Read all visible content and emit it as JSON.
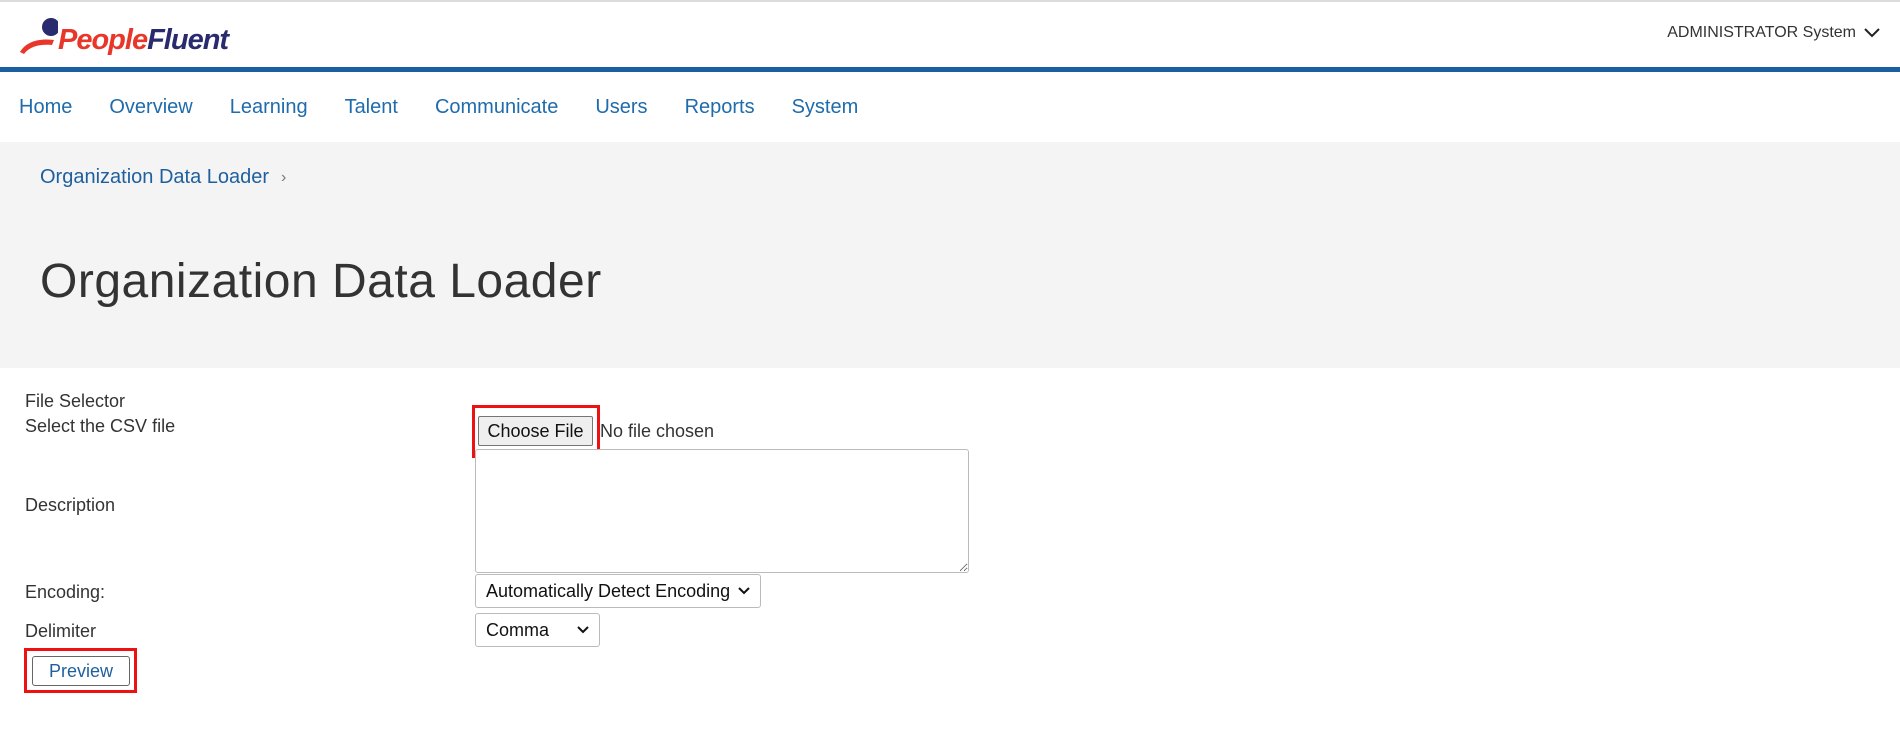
{
  "brand": {
    "name_part1": "People",
    "name_part2": "Fluent",
    "colors": {
      "red": "#e8372a",
      "navy": "#2a2b6e",
      "blue": "#1a5fa0"
    }
  },
  "user_menu": {
    "label": "ADMINISTRATOR System",
    "icon": "chevron-down-icon"
  },
  "nav": {
    "items": [
      {
        "label": "Home"
      },
      {
        "label": "Overview"
      },
      {
        "label": "Learning"
      },
      {
        "label": "Talent"
      },
      {
        "label": "Communicate"
      },
      {
        "label": "Users"
      },
      {
        "label": "Reports"
      },
      {
        "label": "System"
      }
    ]
  },
  "breadcrumb": {
    "item": "Organization Data Loader",
    "separator": "›"
  },
  "page": {
    "title": "Organization Data Loader"
  },
  "form": {
    "file_selector_label": "File Selector",
    "select_csv_label": "Select the CSV file",
    "choose_file_label": "Choose File",
    "no_file_text": "No file chosen",
    "description_label": "Description",
    "description_value": "",
    "encoding_label": "Encoding:",
    "encoding_value": "Automatically Detect Encoding",
    "delimiter_label": "Delimiter",
    "delimiter_value": "Comma",
    "preview_label": "Preview"
  }
}
